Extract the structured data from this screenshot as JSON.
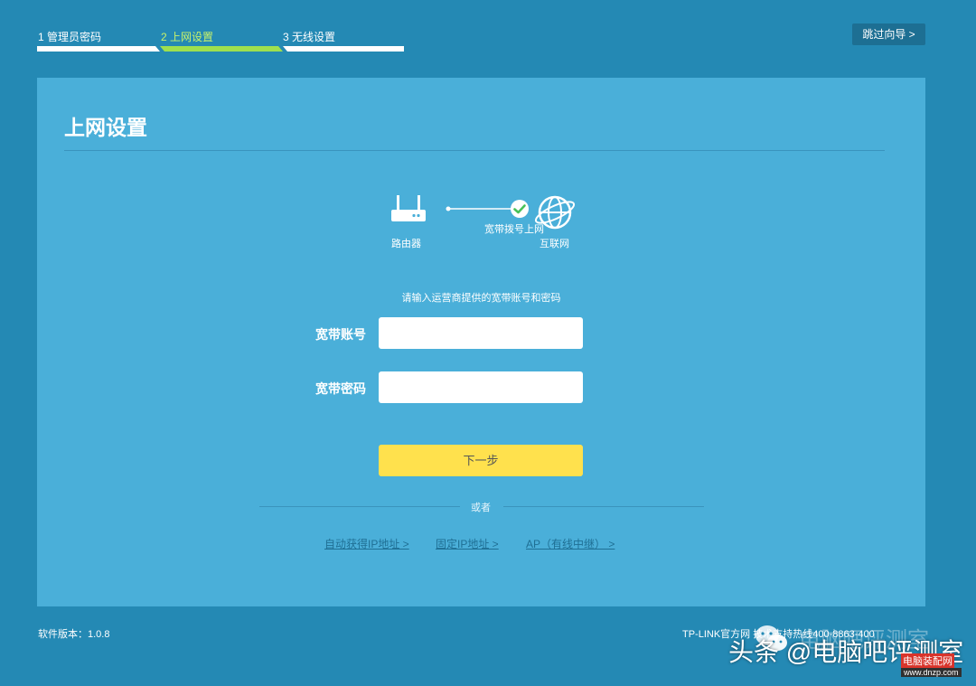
{
  "stepper": {
    "steps": [
      {
        "label": "1 管理员密码",
        "state": "done"
      },
      {
        "label": "2 上网设置",
        "state": "active"
      },
      {
        "label": "3 无线设置",
        "state": "pending"
      }
    ],
    "skip_label": "跳过向导 >"
  },
  "panel": {
    "title": "上网设置",
    "diagram": {
      "router_label": "路由器",
      "connection_label": "宽带拨号上网",
      "internet_label": "互联网",
      "router_icon": "router-icon",
      "status_icon": "check-circle-icon",
      "internet_icon": "globe-icon"
    },
    "hint": "请输入运营商提供的宽带账号和密码",
    "account": {
      "label": "宽带账号",
      "value": "",
      "placeholder": ""
    },
    "password": {
      "label": "宽带密码",
      "value": "",
      "placeholder": ""
    },
    "next_label": "下一步",
    "or_label": "或者",
    "alt_links": [
      "自动获得IP地址 >",
      "固定IP地址 >",
      "AP（有线中继） >"
    ]
  },
  "footer": {
    "version": "软件版本：1.0.8",
    "right_text": "TP-LINK官方网    技术支持热线400-8863-400"
  },
  "watermark": {
    "text": "头条 @电脑吧评测室",
    "faint_text": "电脑吧评测室",
    "logo_top": "电脑装配网",
    "logo_bottom": "www.dnzp.com"
  },
  "colors": {
    "background": "#2489b4",
    "panel": "#4aafd9",
    "active_step": "#9ee04e",
    "next_button": "#ffe14d",
    "link": "#1f6f94"
  }
}
